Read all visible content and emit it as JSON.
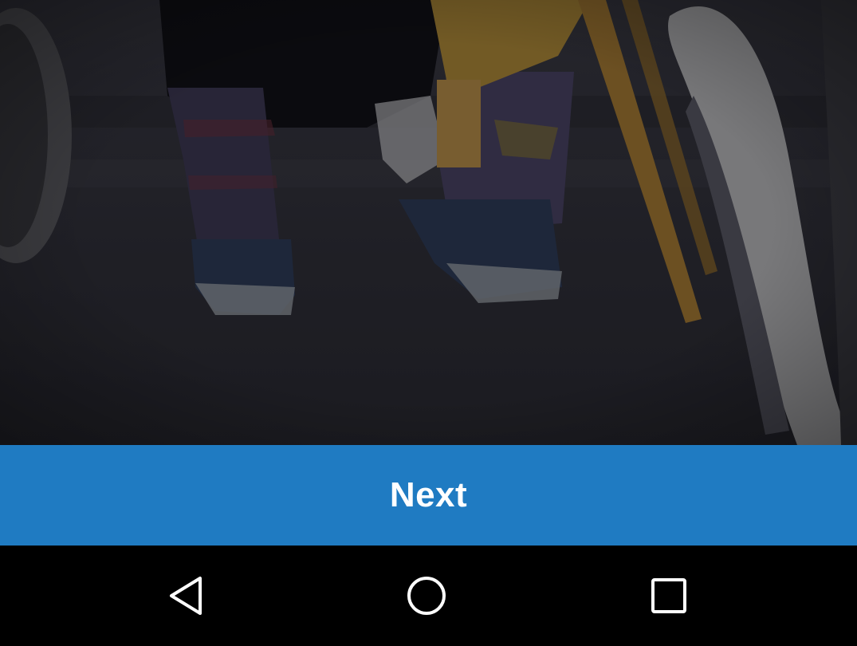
{
  "hero": {
    "description_icon": "photo-background"
  },
  "next_button": {
    "label": "Next",
    "background_color": "#1f7bc2",
    "text_color": "#ffffff"
  },
  "navigation_bar": {
    "background_color": "#000000",
    "icon_color": "#ffffff",
    "buttons": [
      {
        "icon": "back-triangle-icon"
      },
      {
        "icon": "home-circle-icon"
      },
      {
        "icon": "recents-square-icon"
      }
    ]
  }
}
